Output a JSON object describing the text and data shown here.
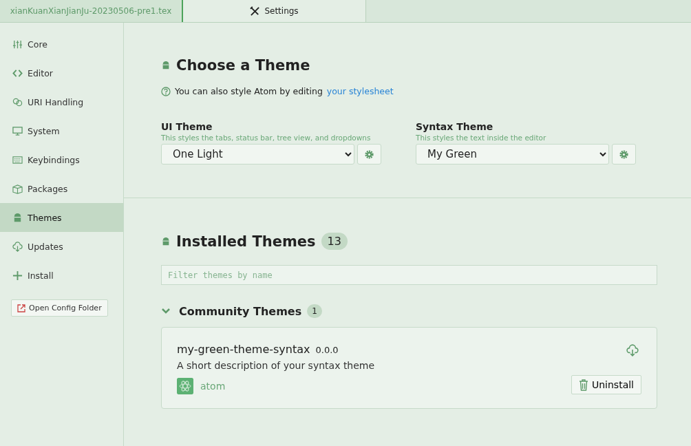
{
  "tabs": [
    {
      "label": "xianKuanXianJianJu-20230506-pre1.tex",
      "selected": false
    },
    {
      "label": "Settings",
      "selected": true,
      "kind": "settings"
    }
  ],
  "sidebar": {
    "items": [
      {
        "label": "Core",
        "kind": "sliders",
        "selected": false
      },
      {
        "label": "Editor",
        "kind": "code",
        "selected": false
      },
      {
        "label": "URI Handling",
        "kind": "link",
        "selected": false
      },
      {
        "label": "System",
        "kind": "monitor",
        "selected": false
      },
      {
        "label": "Keybindings",
        "kind": "keyboard",
        "selected": false
      },
      {
        "label": "Packages",
        "kind": "package",
        "selected": false
      },
      {
        "label": "Themes",
        "kind": "bucket",
        "selected": true
      },
      {
        "label": "Updates",
        "kind": "cloud",
        "selected": false
      },
      {
        "label": "Install",
        "kind": "plus",
        "selected": false
      }
    ],
    "button": "Open Config Folder"
  },
  "choose_theme": {
    "title": "Choose a Theme",
    "note": "You can also style Atom by editing",
    "note_link": "your stylesheet",
    "pickers": [
      {
        "label": "UI Theme",
        "hint": "This styles the tabs, status bar, tree view, and dropdowns",
        "value": "One Light"
      },
      {
        "label": "Syntax Theme",
        "hint": "This styles the text inside the editor",
        "value": "My Green"
      }
    ]
  },
  "installed": {
    "title": "Installed Themes",
    "count": "13",
    "filter": {
      "placeholder": "Filter themes by name"
    },
    "groups": [
      {
        "title": "Community Themes",
        "count": "1",
        "expanded": true,
        "packages": [
          {
            "name": "my-green-theme-syntax",
            "version": "0.0.0",
            "description": "A short description of your syntax theme",
            "author": "atom",
            "button": "Uninstall"
          }
        ]
      }
    ]
  }
}
